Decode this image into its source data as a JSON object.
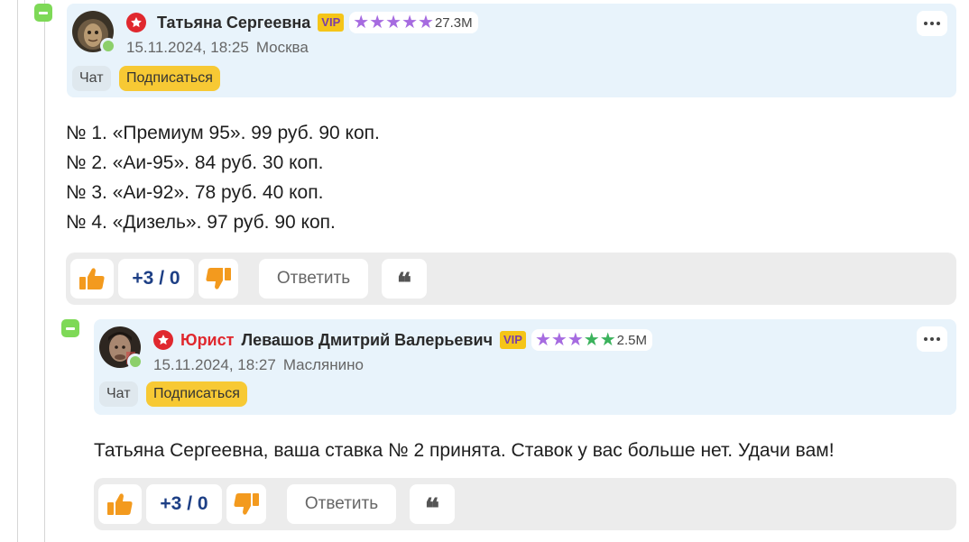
{
  "colors": {
    "card_bg": "#e8f3fb",
    "collapse_green": "#7ed957",
    "badge_red": "#e0282e",
    "vip_yellow": "#f5c518",
    "vip_text": "#7a3ea6",
    "star_purple": "#a66be0",
    "star_green": "#3bb25c",
    "score_blue": "#1d3f85",
    "thumb_orange": "#f39a1e"
  },
  "comments": [
    {
      "author": "Татьяна Сергеевна",
      "role": "",
      "vip": "VIP",
      "stars": [
        "purple",
        "purple",
        "purple",
        "purple",
        "purple"
      ],
      "rating": "27.3M",
      "date": "15.11.2024, 18:25",
      "city": "Москва",
      "chat_label": "Чат",
      "subscribe_label": "Подписаться",
      "lines": [
        "№ 1. «Премиум 95». 99 руб. 90 коп.",
        "№ 2. «Аи-95». 84 руб. 30 коп.",
        "№ 3. «Аи-92». 78 руб. 40 коп.",
        "№ 4. «Дизель». 97 руб. 90 коп."
      ],
      "score": "+3 / 0",
      "reply_label": "Ответить",
      "quote_glyph": "❝"
    },
    {
      "author": "Левашов Дмитрий Валерьевич",
      "role": "Юрист",
      "vip": "VIP",
      "stars": [
        "purple",
        "purple",
        "purple",
        "green",
        "green"
      ],
      "rating": "2.5M",
      "date": "15.11.2024, 18:27",
      "city": "Маслянино",
      "chat_label": "Чат",
      "subscribe_label": "Подписаться",
      "lines": [
        "Татьяна Сергеевна, ваша ставка № 2 принята. Ставок у вас больше нет. Удачи вам!"
      ],
      "score": "+3 / 0",
      "reply_label": "Ответить",
      "quote_glyph": "❝"
    }
  ]
}
